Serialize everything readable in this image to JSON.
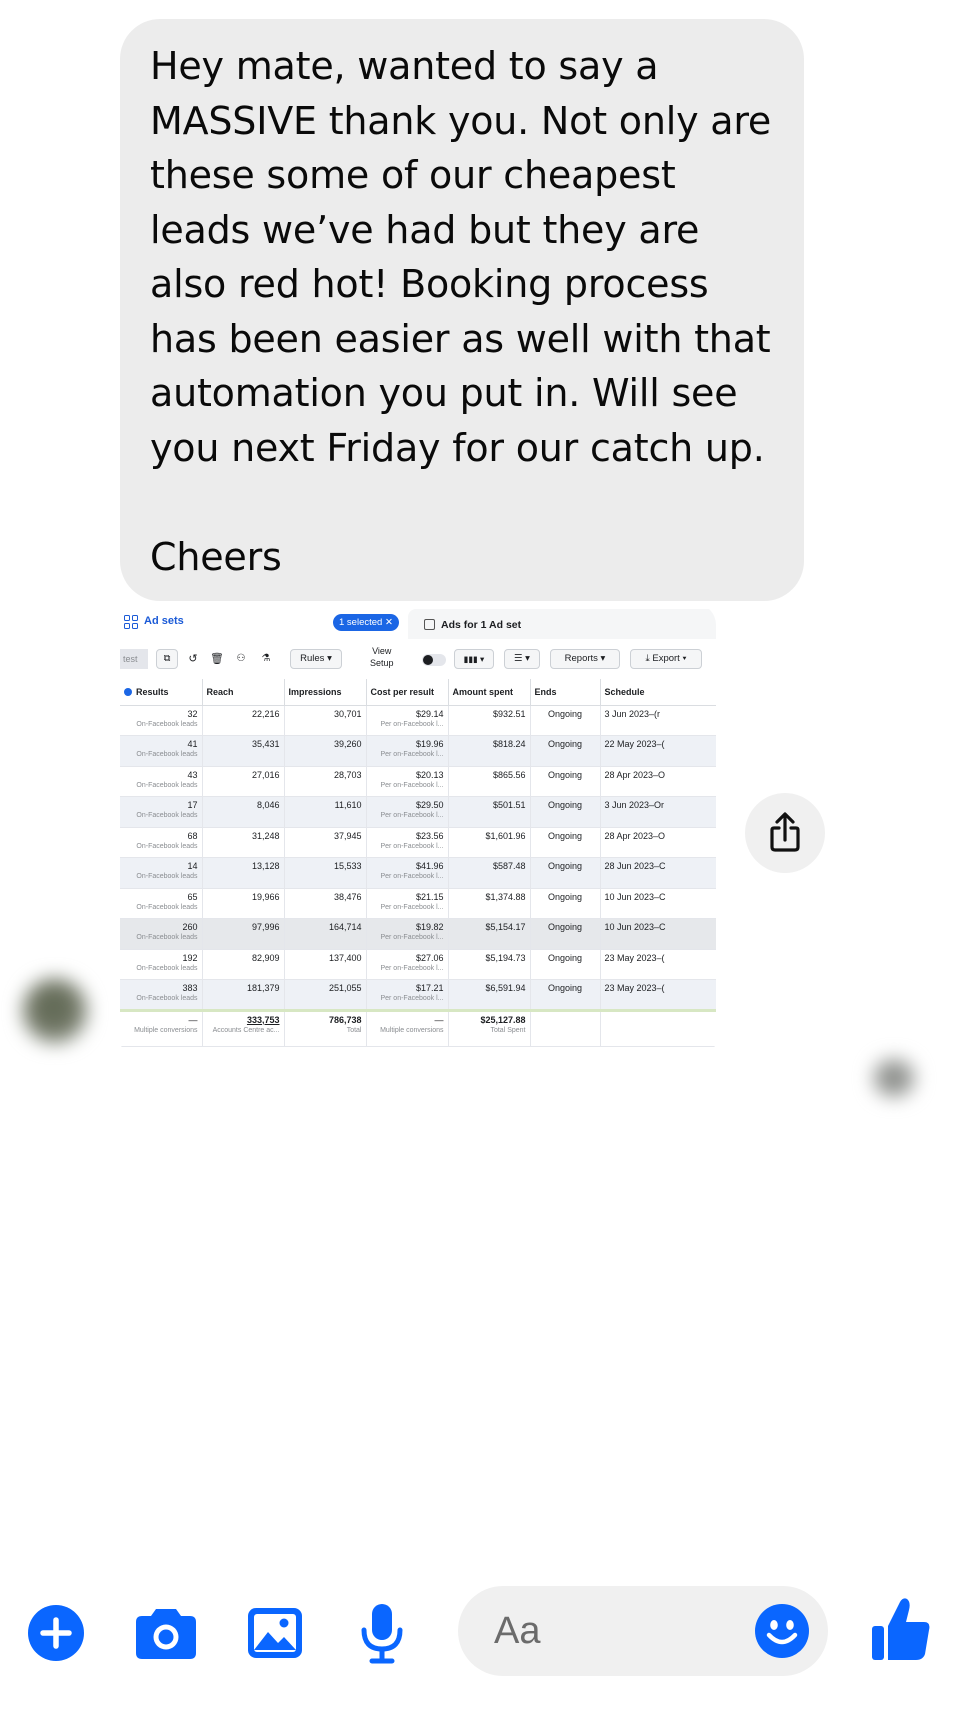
{
  "message": {
    "text": "Hey mate, wanted to say a\nMASSIVE thank you. Not only are\nthese some of our cheapest\nleads we’ve had but they are\nalso red hot! Booking process\nhas been easier as well with that\nautomation you put in. Will see\nyou next Friday for our catch up.\n\nCheers"
  },
  "attachment": {
    "tabs": {
      "ad_sets": "Ad sets",
      "selected_pill": "1 selected ✕",
      "ads_for": "Ads for 1 Ad set"
    },
    "toolbar": {
      "search_text": "test",
      "rules": "Rules ▾",
      "view_setup": "View\nSetup",
      "columns": "▮▮▮ ▾",
      "breakdown": "☰ ▾",
      "reports": "Reports ▾",
      "export": "⤓ Export ▾"
    },
    "columns": [
      "Results",
      "Reach",
      "Impressions",
      "Cost per result",
      "Amount spent",
      "Ends",
      "Schedule"
    ],
    "result_sublabel": "On-Facebook leads",
    "cost_sublabel": "Per on-Facebook l...",
    "rows": [
      {
        "results": "32",
        "reach": "22,216",
        "impressions": "30,701",
        "cost": "$29.14",
        "spent": "$932.51",
        "ends": "Ongoing",
        "schedule": "3 Jun 2023–(r"
      },
      {
        "results": "41",
        "reach": "35,431",
        "impressions": "39,260",
        "cost": "$19.96",
        "spent": "$818.24",
        "ends": "Ongoing",
        "schedule": "22 May 2023–("
      },
      {
        "results": "43",
        "reach": "27,016",
        "impressions": "28,703",
        "cost": "$20.13",
        "spent": "$865.56",
        "ends": "Ongoing",
        "schedule": "28 Apr 2023–O"
      },
      {
        "results": "17",
        "reach": "8,046",
        "impressions": "11,610",
        "cost": "$29.50",
        "spent": "$501.51",
        "ends": "Ongoing",
        "schedule": "3 Jun 2023–Or"
      },
      {
        "results": "68",
        "reach": "31,248",
        "impressions": "37,945",
        "cost": "$23.56",
        "spent": "$1,601.96",
        "ends": "Ongoing",
        "schedule": "28 Apr 2023–O"
      },
      {
        "results": "14",
        "reach": "13,128",
        "impressions": "15,533",
        "cost": "$41.96",
        "spent": "$587.48",
        "ends": "Ongoing",
        "schedule": "28 Jun 2023–C"
      },
      {
        "results": "65",
        "reach": "19,966",
        "impressions": "38,476",
        "cost": "$21.15",
        "spent": "$1,374.88",
        "ends": "Ongoing",
        "schedule": "10 Jun 2023–C"
      },
      {
        "results": "260",
        "reach": "97,996",
        "impressions": "164,714",
        "cost": "$19.82",
        "spent": "$5,154.17",
        "ends": "Ongoing",
        "schedule": "10 Jun 2023–C"
      },
      {
        "results": "192",
        "reach": "82,909",
        "impressions": "137,400",
        "cost": "$27.06",
        "spent": "$5,194.73",
        "ends": "Ongoing",
        "schedule": "23 May 2023–("
      },
      {
        "results": "383",
        "reach": "181,379",
        "impressions": "251,055",
        "cost": "$17.21",
        "spent": "$6,591.94",
        "ends": "Ongoing",
        "schedule": "23 May 2023–("
      }
    ],
    "totals": {
      "results": "—",
      "results_sub": "Multiple conversions",
      "reach": "333,753",
      "reach_sub": "Accounts Centre ac...",
      "impressions": "786,738",
      "impressions_sub": "Total",
      "cost": "—",
      "cost_sub": "Multiple conversions",
      "spent": "$25,127.88",
      "spent_sub": "Total Spent"
    }
  },
  "composer": {
    "placeholder": "Aa",
    "icons": [
      "plus-icon",
      "camera-icon",
      "gallery-icon",
      "microphone-icon",
      "emoji-icon",
      "thumbs-up-icon"
    ],
    "accent": "#0a66ff"
  },
  "share_icon": "share-icon"
}
